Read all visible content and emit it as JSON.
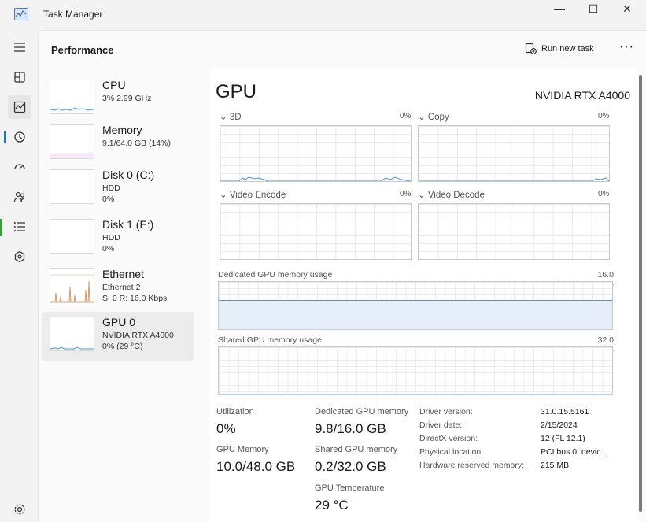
{
  "window": {
    "title": "Task Manager",
    "controls": {
      "minimize": "—",
      "maximize": "☐",
      "close": "✕"
    }
  },
  "header": {
    "title": "Performance",
    "run_new_task": "Run new task",
    "more": "···"
  },
  "nav": {
    "items": [
      "hamburger-menu-icon",
      "processes-icon",
      "performance-icon",
      "app-history-icon",
      "startup-apps-icon",
      "users-icon",
      "details-icon",
      "services-icon"
    ],
    "settings": "settings-icon"
  },
  "sidebar": {
    "items": [
      {
        "name": "CPU",
        "sub1": "3% 2.99 GHz",
        "sub2": "",
        "sub3": ""
      },
      {
        "name": "Memory",
        "sub1": "9.1/64.0 GB (14%)",
        "sub2": "",
        "sub3": ""
      },
      {
        "name": "Disk 0 (C:)",
        "sub1": "HDD",
        "sub2": "0%",
        "sub3": ""
      },
      {
        "name": "Disk 1 (E:)",
        "sub1": "HDD",
        "sub2": "0%",
        "sub3": ""
      },
      {
        "name": "Ethernet",
        "sub1": "Ethernet 2",
        "sub2": "S: 0 R: 16.0 Kbps",
        "sub3": ""
      },
      {
        "name": "GPU 0",
        "sub1": "NVIDIA RTX A4000",
        "sub2": "0% (29 °C)",
        "sub3": ""
      }
    ],
    "selected_index": 5
  },
  "main": {
    "title": "GPU",
    "model": "NVIDIA RTX A4000",
    "graphs": [
      {
        "label": "3D",
        "pct": "0%"
      },
      {
        "label": "Copy",
        "pct": "0%"
      },
      {
        "label": "Video Encode",
        "pct": "0%"
      },
      {
        "label": "Video Decode",
        "pct": "0%"
      }
    ],
    "dedicated_memory": {
      "label": "Dedicated GPU memory usage",
      "max": "16.0 GB",
      "fraction": 0.6125
    },
    "shared_memory": {
      "label": "Shared GPU memory usage",
      "max": "32.0 GB",
      "fraction": 0.00625
    },
    "stats": {
      "utilization_label": "Utilization",
      "utilization_value": "0%",
      "dedicated_label": "Dedicated GPU memory",
      "dedicated_value": "9.8/16.0 GB",
      "gpu_memory_label": "GPU Memory",
      "gpu_memory_value": "10.0/48.0 GB",
      "shared_label": "Shared GPU memory",
      "shared_value": "0.2/32.0 GB",
      "temp_label": "GPU Temperature",
      "temp_value": "29 °C"
    },
    "details": [
      {
        "label": "Driver version:",
        "value": "31.0.15.5161"
      },
      {
        "label": "Driver date:",
        "value": "2/15/2024"
      },
      {
        "label": "DirectX version:",
        "value": "12 (FL 12.1)"
      },
      {
        "label": "Physical location:",
        "value": "PCI bus 0, devic..."
      },
      {
        "label": "Hardware reserved memory:",
        "value": "215 MB"
      }
    ]
  },
  "colors": {
    "accent": "#1f6fd1",
    "gpu_line": "#4a90d9",
    "memory_line": "#8a3fb8",
    "ethernet_line": "#d58b4a"
  }
}
